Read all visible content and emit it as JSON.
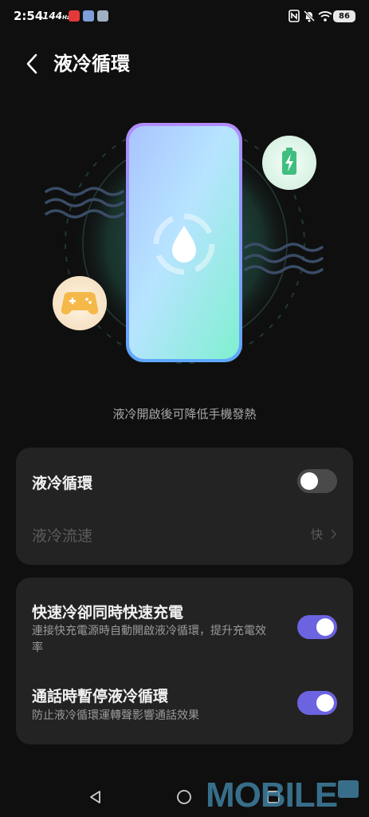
{
  "status_bar": {
    "time": "2:54",
    "refresh_rate": "144",
    "refresh_unit": "Hz",
    "battery": "86"
  },
  "header": {
    "title": "液冷循環"
  },
  "hero": {
    "caption": "液冷開啟後可降低手機發熱"
  },
  "settings": {
    "liquid_cooling": {
      "label": "液冷循環",
      "enabled": false
    },
    "flow_speed": {
      "label": "液冷流速",
      "value": "快"
    },
    "fast_cool_charge": {
      "label": "快速冷卻同時快速充電",
      "description": "連接快充電源時自動開啟液冷循環，提升充電效率",
      "enabled": true
    },
    "pause_on_call": {
      "label": "通話時暫停液冷循環",
      "description": "防止液冷循環運轉聲影響通話效果",
      "enabled": true
    }
  },
  "watermark": "MOBILE",
  "colors": {
    "background": "#0f0f0f",
    "card": "#232323",
    "accent_toggle": "#6b63e0",
    "caption": "#a7a7a7"
  }
}
